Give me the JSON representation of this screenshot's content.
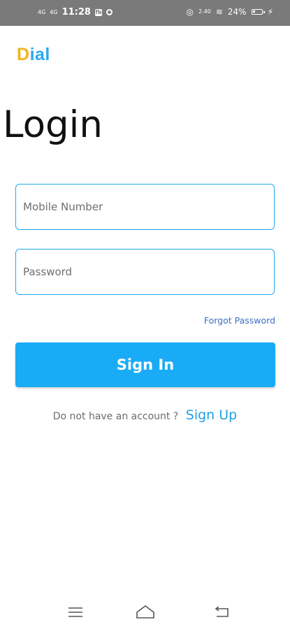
{
  "status_bar": {
    "signal_1": "4G",
    "signal_2": "4G",
    "time": "11:28",
    "badge": "fb",
    "data_speed": "2.40",
    "battery": "24%",
    "battery_level": 0.24
  },
  "app": {
    "logo_first": "D",
    "logo_rest": "ial"
  },
  "login": {
    "title": "Login",
    "mobile_placeholder": "Mobile Number",
    "password_placeholder": "Password",
    "forgot_label": "Forgot Password",
    "signin_label": "Sign In",
    "signup_prompt": "Do not have an account ?",
    "signup_label": "Sign Up"
  },
  "colors": {
    "accent": "#1AABF6",
    "logo_blue": "#29A9F0",
    "logo_yellow": "#F2B21D",
    "link": "#3C6FC2"
  },
  "nav_icons": [
    "menu-icon",
    "home-icon",
    "back-icon"
  ]
}
